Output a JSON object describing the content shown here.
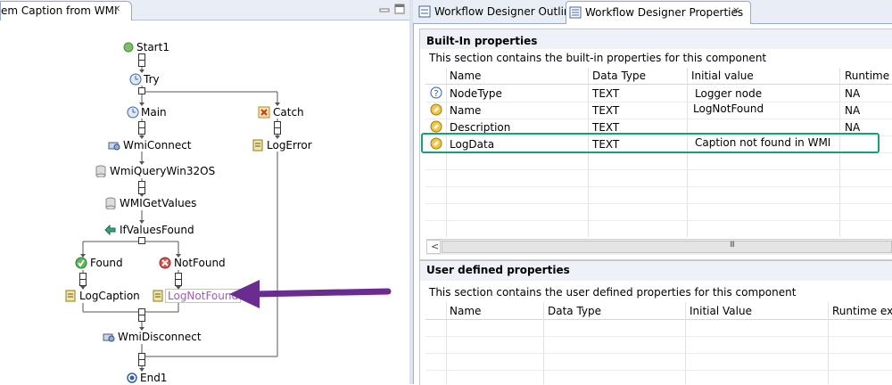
{
  "left_tab": {
    "title": "em Caption from WMI",
    "close": "✕"
  },
  "workflow": {
    "nodes": {
      "start": "Start1",
      "try": "Try",
      "main": "Main",
      "catch": "Catch",
      "wmiconnect": "WmiConnect",
      "logerror": "LogError",
      "wmiquery": "WmiQueryWin32OS",
      "wmigetvalues": "WMIGetValues",
      "ifvaluesfound": "IfValuesFound",
      "found": "Found",
      "notfound": "NotFound",
      "logcaption": "LogCaption",
      "lognotfound": "LogNotFound",
      "wmidisconnect": "WmiDisconnect",
      "end": "End1"
    }
  },
  "right_tabs": [
    {
      "label": "Workflow Designer Outline"
    },
    {
      "label": "Workflow Designer Properties",
      "close": "✕"
    }
  ],
  "builtin": {
    "title": "Built-In properties",
    "description": "This section contains the built-in properties for this component",
    "columns": [
      "Name",
      "Data Type",
      "Initial value",
      "Runtime e"
    ],
    "rows": [
      {
        "name": "NodeType",
        "type": "TEXT",
        "value": "Logger node",
        "runtime": "NA"
      },
      {
        "name": "Name",
        "type": "TEXT",
        "value": "LogNotFound",
        "runtime": "NA"
      },
      {
        "name": "Description",
        "type": "TEXT",
        "value": "",
        "runtime": "NA"
      },
      {
        "name": "LogData",
        "type": "TEXT",
        "value": "Caption not found in WMI",
        "runtime": ""
      }
    ],
    "scroll_left": "<",
    "scroll_thumb": "III"
  },
  "userdef": {
    "title": "User defined properties",
    "description": "This section contains the user defined properties for this component",
    "columns": [
      "Name",
      "Data Type",
      "Initial Value",
      "Runtime expr"
    ]
  },
  "colors": {
    "highlight": "#1a9e7a",
    "arrow": "#6a2c8f",
    "selection": "#a25bbf"
  }
}
